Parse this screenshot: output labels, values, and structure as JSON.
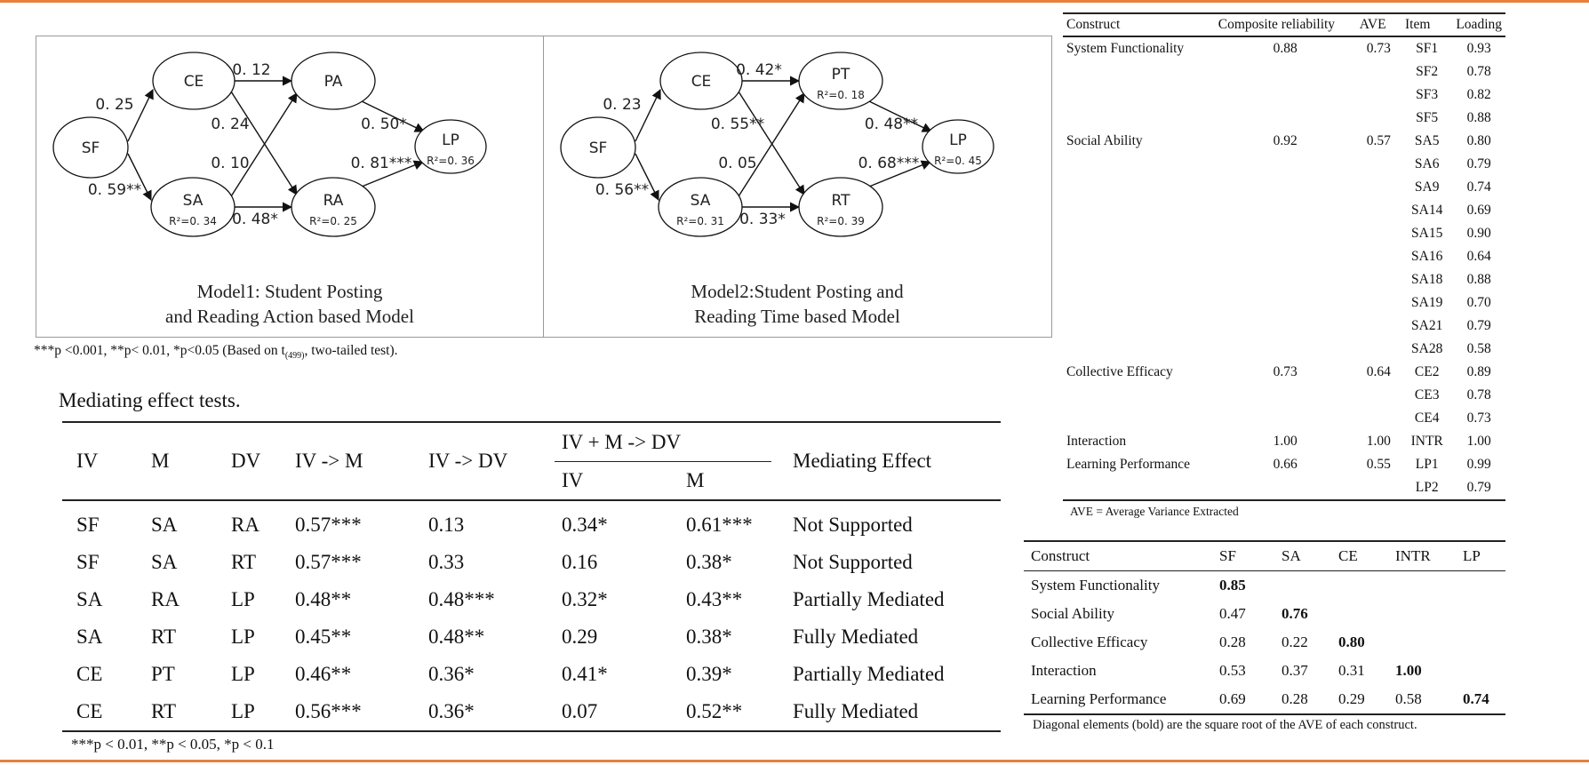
{
  "diagrams": {
    "model1": {
      "caption_line1": "Model1: Student Posting",
      "caption_line2": "and Reading Action based Model",
      "nodes": {
        "SF": {
          "label": "SF",
          "r2": ""
        },
        "CE": {
          "label": "CE",
          "r2": ""
        },
        "SA": {
          "label": "SA",
          "r2": "R²=0. 34"
        },
        "PA": {
          "label": "PA",
          "r2": ""
        },
        "RA": {
          "label": "RA",
          "r2": "R²=0. 25"
        },
        "LP": {
          "label": "LP",
          "r2": "R²=0. 36"
        }
      },
      "paths": {
        "sf_ce": "0. 25",
        "sf_sa": "0. 59**",
        "ce_pa": "0. 12",
        "ce_ra": "0. 24",
        "sa_pa": "0. 10",
        "sa_ra": "0. 48*",
        "pa_lp": "0. 50*",
        "ra_lp": "0. 81***"
      }
    },
    "model2": {
      "caption_line1": "Model2:Student Posting and",
      "caption_line2": "Reading Time based Model",
      "nodes": {
        "SF": {
          "label": "SF",
          "r2": ""
        },
        "CE": {
          "label": "CE",
          "r2": ""
        },
        "SA": {
          "label": "SA",
          "r2": "R²=0. 31"
        },
        "PT": {
          "label": "PT",
          "r2": "R²=0. 18"
        },
        "RT": {
          "label": "RT",
          "r2": "R²=0. 39"
        },
        "LP": {
          "label": "LP",
          "r2": "R²=0. 45"
        }
      },
      "paths": {
        "sf_ce": "0. 23",
        "sf_sa": "0. 56**",
        "ce_pt": "0. 42*",
        "ce_rt": "0. 55**",
        "sa_pt": "0. 05",
        "sa_rt": "0. 33*",
        "pt_lp": "0. 48**",
        "rt_lp": "0. 68***"
      }
    },
    "significance_note": {
      "prefix": "***p <0.001, **p< 0.01, *p<0.05 (Based on t",
      "subscript": "(499)",
      "suffix": ", two-tailed test)."
    }
  },
  "mediation": {
    "caption": "Mediating effect tests.",
    "headers": {
      "iv": "IV",
      "m": "M",
      "dv": "DV",
      "iv_m": "IV -> M",
      "iv_dv": "IV -> DV",
      "combined": "IV + M -> DV",
      "combined_iv": "IV",
      "combined_m": "M",
      "effect": "Mediating Effect"
    },
    "rows": [
      {
        "iv": "SF",
        "m": "SA",
        "dv": "RA",
        "iv_m": "0.57***",
        "iv_dv": "0.13",
        "c_iv": "0.34*",
        "c_m": "0.61***",
        "effect": "Not Supported"
      },
      {
        "iv": "SF",
        "m": "SA",
        "dv": "RT",
        "iv_m": "0.57***",
        "iv_dv": "0.33",
        "c_iv": "0.16",
        "c_m": "0.38*",
        "effect": "Not Supported"
      },
      {
        "iv": "SA",
        "m": "RA",
        "dv": "LP",
        "iv_m": "0.48**",
        "iv_dv": "0.48***",
        "c_iv": "0.32*",
        "c_m": "0.43**",
        "effect": "Partially Mediated"
      },
      {
        "iv": "SA",
        "m": "RT",
        "dv": "LP",
        "iv_m": "0.45**",
        "iv_dv": "0.48**",
        "c_iv": "0.29",
        "c_m": "0.38*",
        "effect": "Fully Mediated"
      },
      {
        "iv": "CE",
        "m": "PT",
        "dv": "LP",
        "iv_m": "0.46**",
        "iv_dv": "0.36*",
        "c_iv": "0.41*",
        "c_m": "0.39*",
        "effect": "Partially Mediated"
      },
      {
        "iv": "CE",
        "m": "RT",
        "dv": "LP",
        "iv_m": "0.56***",
        "iv_dv": "0.36*",
        "c_iv": "0.07",
        "c_m": "0.52**",
        "effect": "Fully Mediated"
      }
    ],
    "note": "***p < 0.01, **p < 0.05, *p < 0.1"
  },
  "reliability": {
    "headers": {
      "construct": "Construct",
      "cr": "Composite reliability",
      "ave": "AVE",
      "item": "Item",
      "loading": "Loading"
    },
    "rows": [
      {
        "construct": "System Functionality",
        "cr": "0.88",
        "ave": "0.73",
        "item": "SF1",
        "loading": "0.93"
      },
      {
        "construct": "",
        "cr": "",
        "ave": "",
        "item": "SF2",
        "loading": "0.78"
      },
      {
        "construct": "",
        "cr": "",
        "ave": "",
        "item": "SF3",
        "loading": "0.82"
      },
      {
        "construct": "",
        "cr": "",
        "ave": "",
        "item": "SF5",
        "loading": "0.88"
      },
      {
        "construct": "Social Ability",
        "cr": "0.92",
        "ave": "0.57",
        "item": "SA5",
        "loading": "0.80"
      },
      {
        "construct": "",
        "cr": "",
        "ave": "",
        "item": "SA6",
        "loading": "0.79"
      },
      {
        "construct": "",
        "cr": "",
        "ave": "",
        "item": "SA9",
        "loading": "0.74"
      },
      {
        "construct": "",
        "cr": "",
        "ave": "",
        "item": "SA14",
        "loading": "0.69"
      },
      {
        "construct": "",
        "cr": "",
        "ave": "",
        "item": "SA15",
        "loading": "0.90"
      },
      {
        "construct": "",
        "cr": "",
        "ave": "",
        "item": "SA16",
        "loading": "0.64"
      },
      {
        "construct": "",
        "cr": "",
        "ave": "",
        "item": "SA18",
        "loading": "0.88"
      },
      {
        "construct": "",
        "cr": "",
        "ave": "",
        "item": "SA19",
        "loading": "0.70"
      },
      {
        "construct": "",
        "cr": "",
        "ave": "",
        "item": "SA21",
        "loading": "0.79"
      },
      {
        "construct": "",
        "cr": "",
        "ave": "",
        "item": "SA28",
        "loading": "0.58"
      },
      {
        "construct": "Collective Efficacy",
        "cr": "0.73",
        "ave": "0.64",
        "item": "CE2",
        "loading": "0.89"
      },
      {
        "construct": "",
        "cr": "",
        "ave": "",
        "item": "CE3",
        "loading": "0.78"
      },
      {
        "construct": "",
        "cr": "",
        "ave": "",
        "item": "CE4",
        "loading": "0.73"
      },
      {
        "construct": "Interaction",
        "cr": "1.00",
        "ave": "1.00",
        "item": "INTR",
        "loading": "1.00"
      },
      {
        "construct": "Learning Performance",
        "cr": "0.66",
        "ave": "0.55",
        "item": "LP1",
        "loading": "0.99"
      },
      {
        "construct": "",
        "cr": "",
        "ave": "",
        "item": "LP2",
        "loading": "0.79"
      }
    ],
    "note": "AVE = Average Variance Extracted"
  },
  "discriminant": {
    "headers": [
      "Construct",
      "SF",
      "SA",
      "CE",
      "INTR",
      "LP"
    ],
    "rows": [
      {
        "construct": "System Functionality",
        "values": [
          "0.85",
          "",
          "",
          "",
          ""
        ]
      },
      {
        "construct": "Social Ability",
        "values": [
          "0.47",
          "0.76",
          "",
          "",
          ""
        ]
      },
      {
        "construct": "Collective Efficacy",
        "values": [
          "0.28",
          "0.22",
          "0.80",
          "",
          ""
        ]
      },
      {
        "construct": "Interaction",
        "values": [
          "0.53",
          "0.37",
          "0.31",
          "1.00",
          ""
        ]
      },
      {
        "construct": "Learning Performance",
        "values": [
          "0.69",
          "0.28",
          "0.29",
          "0.58",
          "0.74"
        ]
      }
    ],
    "note": "Diagonal elements (bold) are the square root of the AVE of each construct."
  }
}
